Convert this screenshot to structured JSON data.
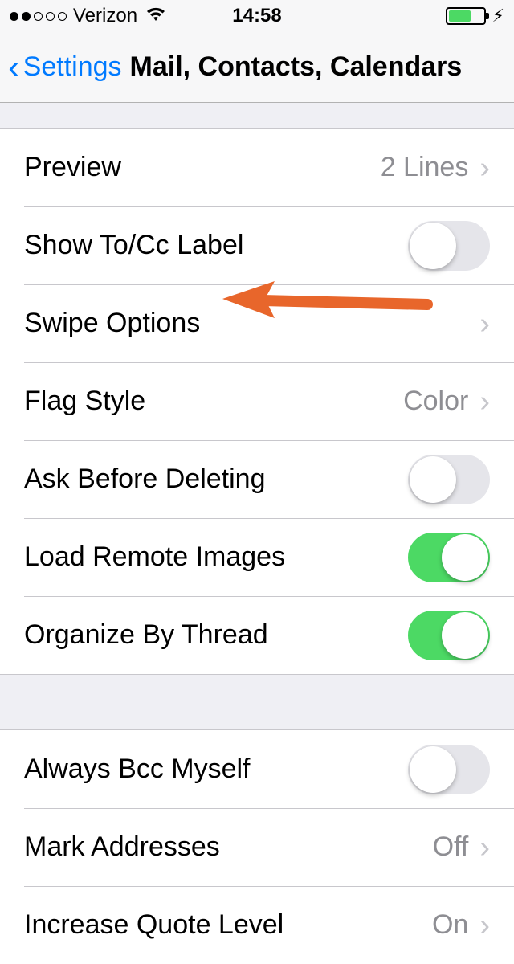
{
  "status": {
    "carrier": "Verizon",
    "time": "14:58"
  },
  "nav": {
    "back_label": "Settings",
    "title": "Mail, Contacts, Calendars"
  },
  "section1": {
    "preview": {
      "label": "Preview",
      "value": "2 Lines"
    },
    "show_tocc": {
      "label": "Show To/Cc Label"
    },
    "swipe": {
      "label": "Swipe Options"
    },
    "flag_style": {
      "label": "Flag Style",
      "value": "Color"
    },
    "ask_delete": {
      "label": "Ask Before Deleting"
    },
    "load_remote": {
      "label": "Load Remote Images"
    },
    "organize_thread": {
      "label": "Organize By Thread"
    }
  },
  "section2": {
    "bcc": {
      "label": "Always Bcc Myself"
    },
    "mark_addresses": {
      "label": "Mark Addresses",
      "value": "Off"
    },
    "quote_level": {
      "label": "Increase Quote Level",
      "value": "On"
    }
  },
  "annotation": {
    "arrow_color": "#e8662b"
  }
}
